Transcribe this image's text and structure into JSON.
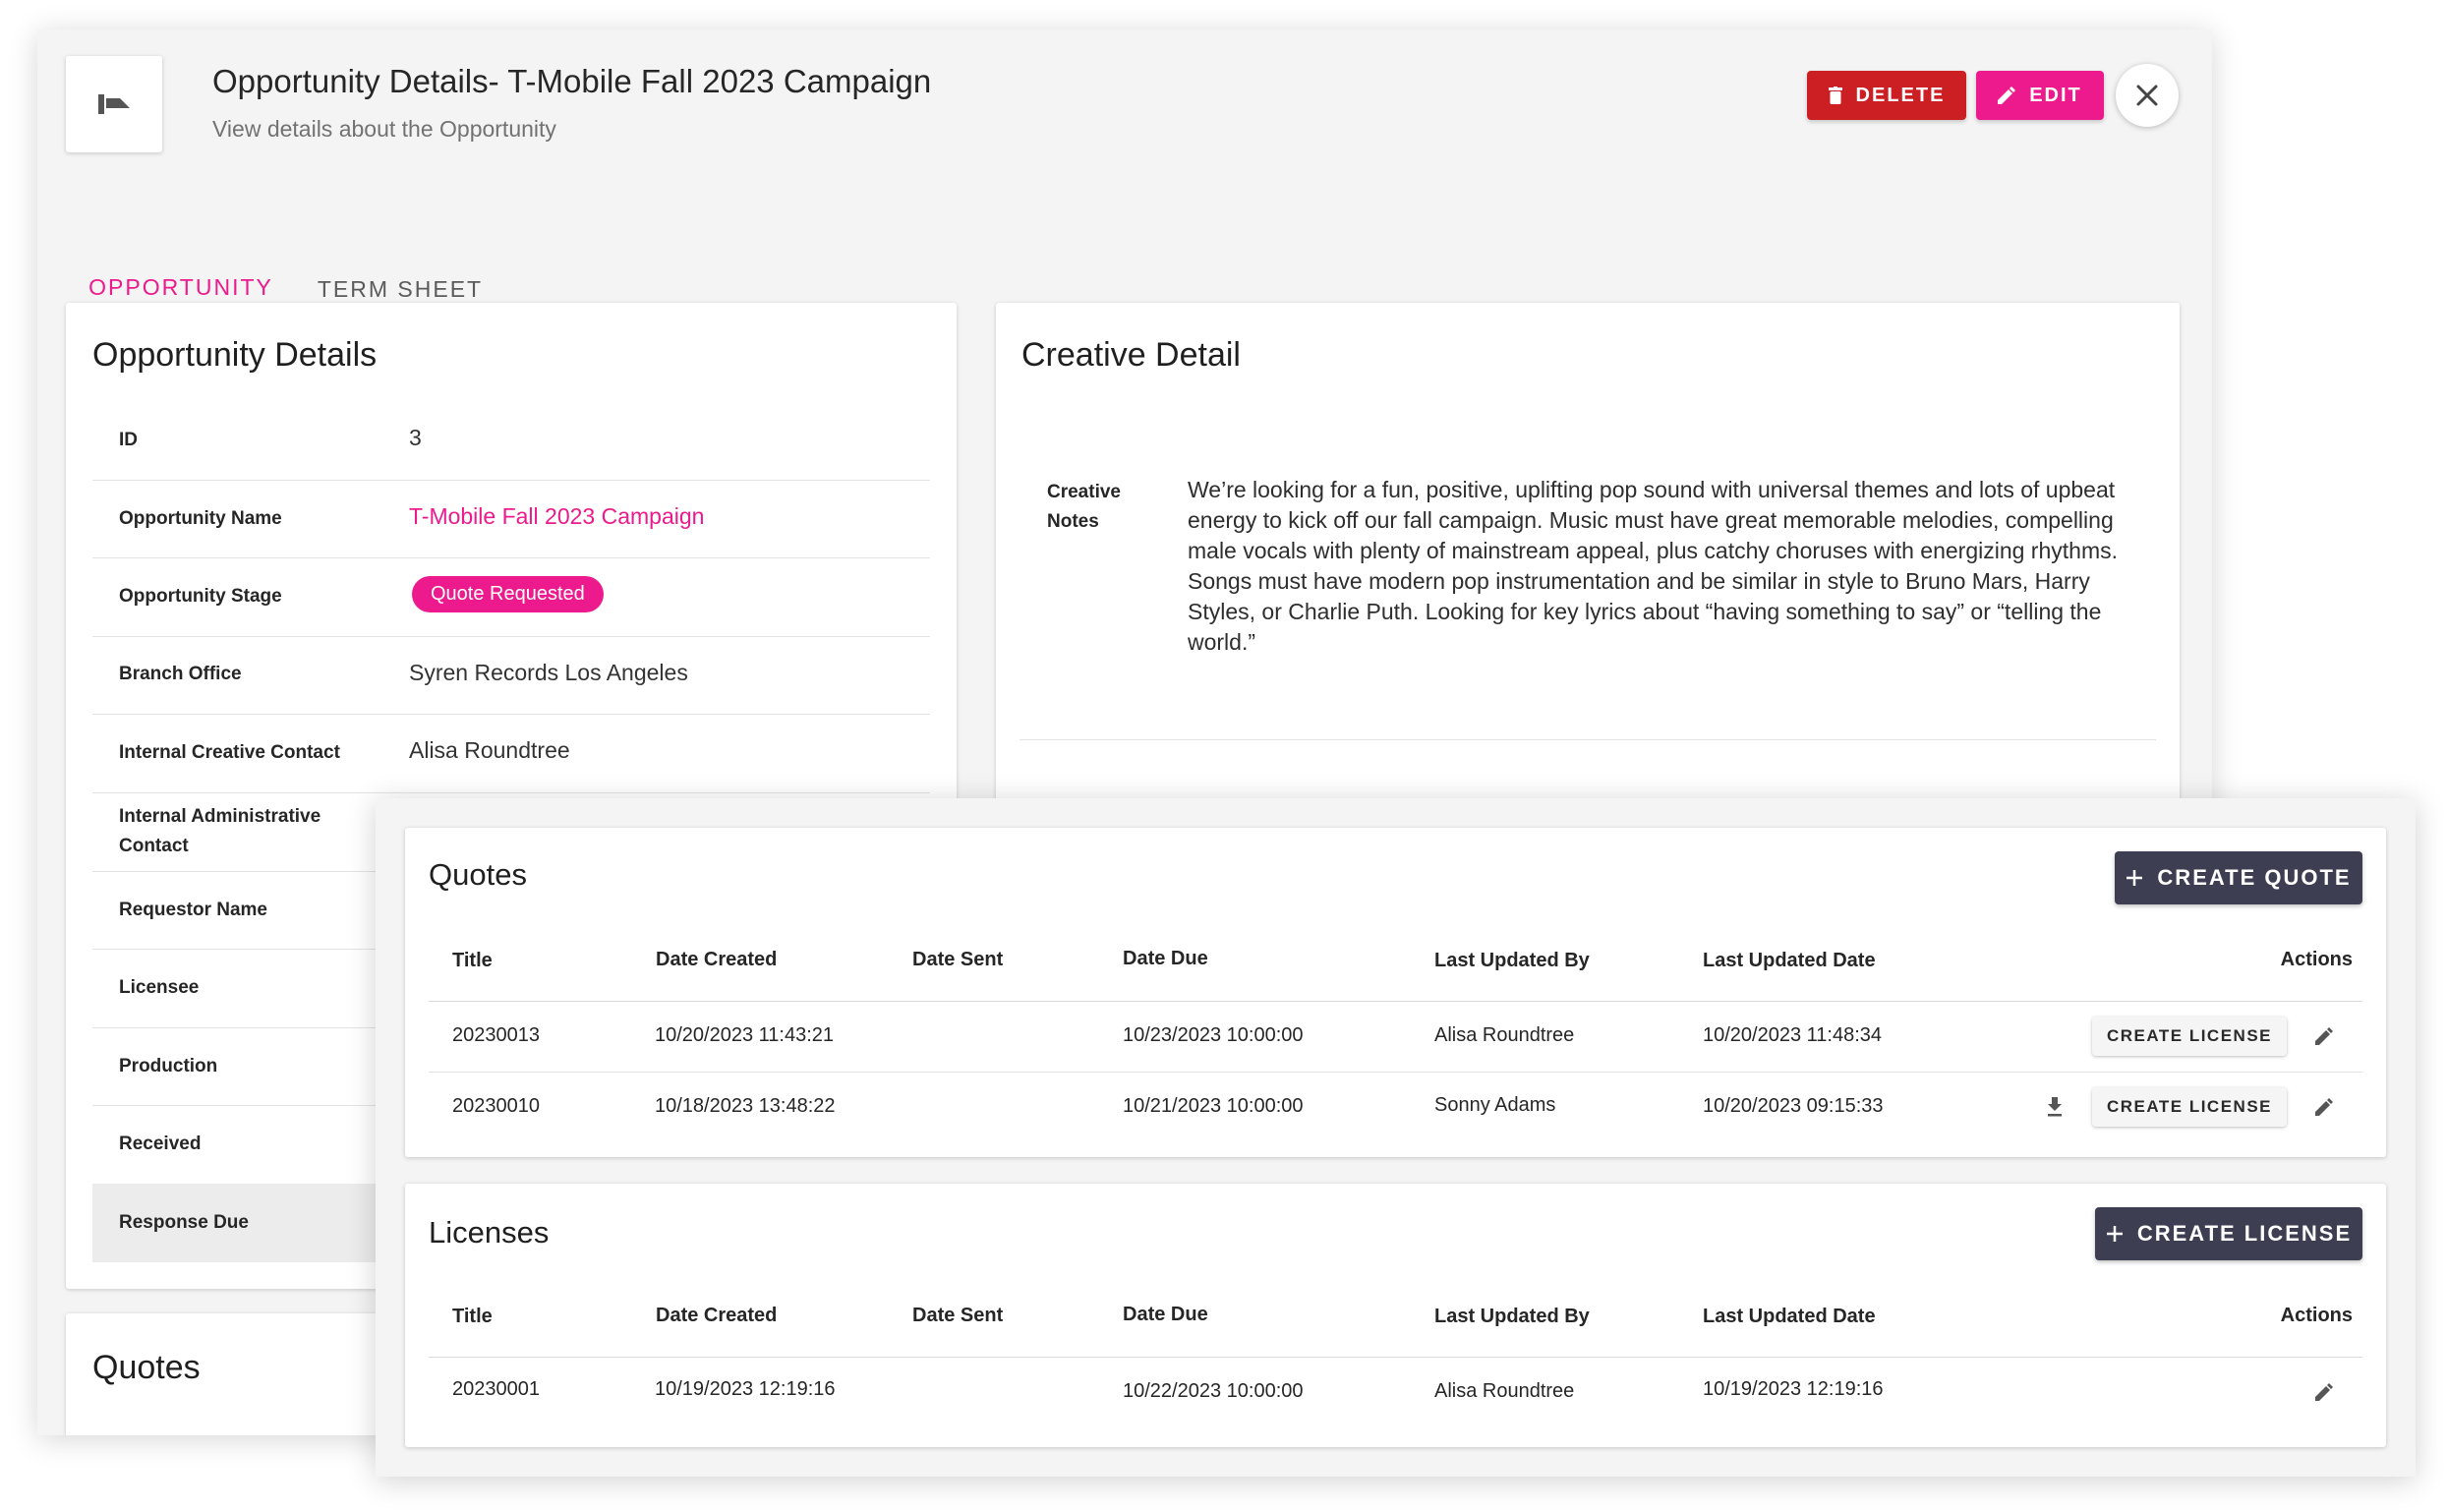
{
  "header": {
    "title": "Opportunity Details- T-Mobile Fall 2023 Campaign",
    "subtitle": "View details about the Opportunity",
    "delete_label": "DELETE",
    "edit_label": "EDIT"
  },
  "tabs": [
    {
      "label": "OPPORTUNITY",
      "active": true
    },
    {
      "label": "TERM SHEET",
      "active": false
    }
  ],
  "opportunity": {
    "title": "Opportunity Details",
    "fields": [
      {
        "label": "ID",
        "value": "3"
      },
      {
        "label": "Opportunity Name",
        "value": "T-Mobile Fall 2023 Campaign"
      },
      {
        "label": "Opportunity Stage",
        "value": "Quote Requested"
      },
      {
        "label": "Branch Office",
        "value": "Syren Records Los Angeles"
      },
      {
        "label": "Internal Creative Contact",
        "value": "Alisa Roundtree"
      },
      {
        "label": "Internal Administrative Contact",
        "value": ""
      },
      {
        "label": "Requestor Name",
        "value": ""
      },
      {
        "label": "Licensee",
        "value": ""
      },
      {
        "label": "Production",
        "value": ""
      },
      {
        "label": "Received",
        "value": ""
      },
      {
        "label": "Response Due",
        "value": ""
      }
    ]
  },
  "creative": {
    "title": "Creative Detail",
    "notes_label": "Creative Notes",
    "notes": "We’re looking for a fun, positive, uplifting pop sound with universal themes and lots of upbeat energy to kick off our fall campaign. Music must have great memorable melodies, compelling male vocals with plenty of mainstream appeal, plus catchy choruses with energizing rhythms. Songs must have modern pop instrumentation and be similar in style to Bruno Mars, Harry Styles, or Charlie Puth. Looking for key lyrics about “having something to say” or “telling the world.”"
  },
  "quotes_back_title": "Quotes",
  "quotes": {
    "title": "Quotes",
    "create_label": "CREATE QUOTE",
    "columns": [
      "Title",
      "Date Created",
      "Date Sent",
      "Date Due",
      "Last Updated By",
      "Last Updated Date",
      "Actions"
    ],
    "rows": [
      {
        "title": "20230013",
        "date_created": "10/20/2023 11:43:21",
        "date_sent": "",
        "date_due": "10/23/2023  10:00:00",
        "updated_by": "Alisa Roundtree",
        "updated_date": "10/20/2023 11:48:34",
        "action_label": "CREATE LICENSE"
      },
      {
        "title": "20230010",
        "date_created": "10/18/2023 13:48:22",
        "date_sent": "",
        "date_due": "10/21/2023  10:00:00",
        "updated_by": "Sonny Adams",
        "updated_date": "10/20/2023 09:15:33",
        "action_label": "CREATE LICENSE"
      }
    ]
  },
  "licenses": {
    "title": "Licenses",
    "create_label": "CREATE LICENSE",
    "columns": [
      "Title",
      "Date Created",
      "Date Sent",
      "Date Due",
      "Last Updated By",
      "Last Updated Date",
      "Actions"
    ],
    "rows": [
      {
        "title": "20230001",
        "date_created": "10/19/2023 12:19:16",
        "date_sent": "",
        "date_due": "10/22/2023  10:00:00",
        "updated_by": "Alisa Roundtree",
        "updated_date": "10/19/2023 12:19:16"
      }
    ]
  },
  "colors": {
    "accent": "#ec1a8c",
    "danger": "#cc1f24",
    "dark_button": "#3e3e52"
  },
  "icons": [
    "app-logo-icon",
    "trash-icon",
    "pencil-icon",
    "close-icon",
    "plus-icon",
    "download-icon"
  ]
}
